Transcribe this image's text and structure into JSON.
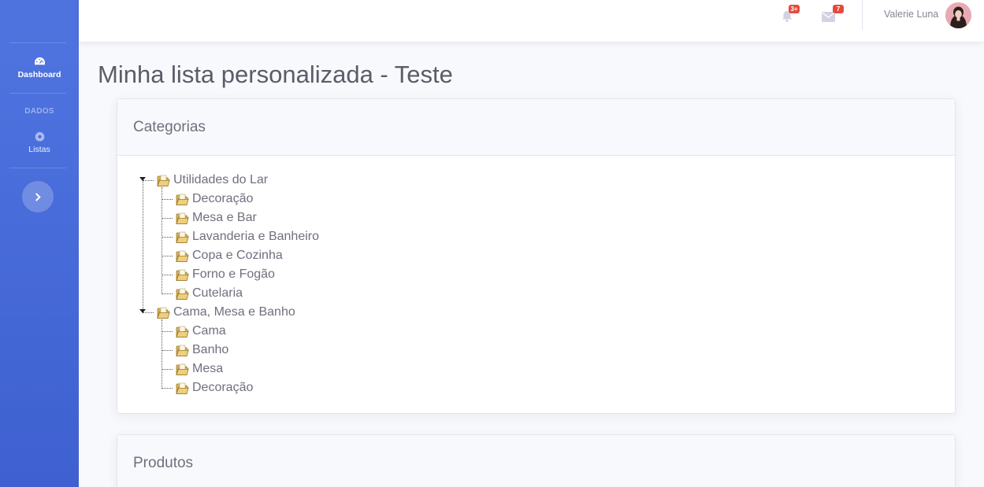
{
  "sidebar": {
    "dashboard_label": "Dashboard",
    "section_heading": "DADOS",
    "listas_label": "Listas"
  },
  "topbar": {
    "alerts_badge": "3+",
    "messages_badge": "7",
    "user_name": "Valerie Luna"
  },
  "page_title": "Minha lista personalizada - Teste",
  "categories_card": {
    "title": "Categorias",
    "groups": [
      {
        "label": "Utilidades do Lar",
        "children": [
          "Decoração",
          "Mesa e Bar",
          "Lavanderia e Banheiro",
          "Copa e Cozinha",
          "Forno e Fogão",
          "Cutelaria"
        ]
      },
      {
        "label": "Cama, Mesa e Banho",
        "children": [
          "Cama",
          "Banho",
          "Mesa",
          "Decoração"
        ]
      }
    ]
  },
  "products_card": {
    "title": "Produtos"
  },
  "colors": {
    "sidebar": "#4e73df",
    "badge": "#e74a3b"
  }
}
